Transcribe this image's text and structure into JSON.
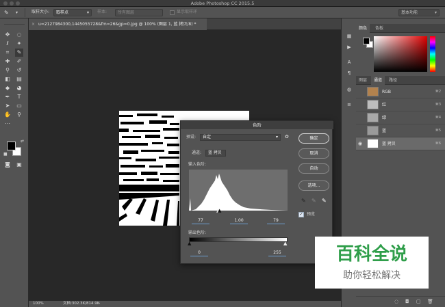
{
  "window": {
    "title": "Adobe Photoshop CC 2015.5"
  },
  "options_bar": {
    "sample_size_label": "取样大小:",
    "sample_size_value": "取样点",
    "sample_label": "样本:",
    "sample_value": "所有图层",
    "show_ring_label": "显示取样环",
    "workspace": "基本功能"
  },
  "document": {
    "tab_title": "u=2127984300,1445055728&fm=26&gp=0.jpg @ 100% (图层 1, 蓝 拷贝/8) *",
    "zoom": "100%",
    "doc_size": "文档:302.3K/814.9K"
  },
  "color_panel": {
    "tabs": [
      "颜色",
      "色板"
    ]
  },
  "channels_panel": {
    "tabs": [
      "图层",
      "通道",
      "路径"
    ],
    "rows": [
      {
        "name": "RGB",
        "shortcut": "⌘2",
        "eye": "",
        "thumb_color": "#b2824e"
      },
      {
        "name": "红",
        "shortcut": "⌘3",
        "eye": "",
        "thumb_color": "#bdbdbd"
      },
      {
        "name": "绿",
        "shortcut": "⌘4",
        "eye": "",
        "thumb_color": "#a9a9a9"
      },
      {
        "name": "蓝",
        "shortcut": "⌘5",
        "eye": "",
        "thumb_color": "#9a9a9a"
      },
      {
        "name": "蓝 拷贝",
        "shortcut": "⌘6",
        "eye": "◉",
        "thumb_color": "#ffffff"
      }
    ]
  },
  "levels_dialog": {
    "title": "色阶",
    "preset_label": "预设:",
    "preset_value": "自定",
    "channel_label": "通道:",
    "channel_value": "蓝 拷贝",
    "input_label": "输入色阶:",
    "input_black": "77",
    "input_gamma": "1.00",
    "input_white": "79",
    "output_label": "输出色阶:",
    "output_black": "0",
    "output_white": "255",
    "ok": "确定",
    "cancel": "取消",
    "auto": "自动",
    "options": "选项...",
    "preview_label": "预览",
    "preview_checked": "✓"
  },
  "watermark": {
    "title": "百科全说",
    "subtitle": "助你轻松解决"
  }
}
